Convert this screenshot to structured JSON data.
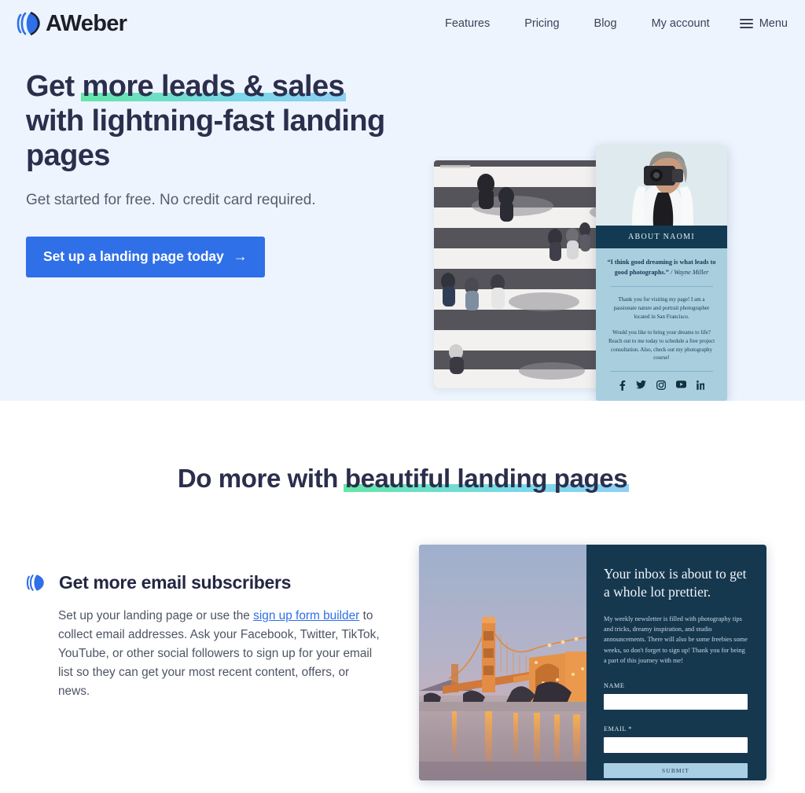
{
  "header": {
    "logo_text": "AWeber",
    "logo_icon": "aweber-mark-icon",
    "nav": [
      {
        "label": "Features"
      },
      {
        "label": "Pricing"
      },
      {
        "label": "Blog"
      },
      {
        "label": "My account"
      }
    ],
    "menu_label": "Menu",
    "menu_icon": "hamburger-icon"
  },
  "hero": {
    "title_part1": "Get ",
    "title_highlight": "more leads & sales",
    "title_part2": "with lightning-fast landing pages",
    "subtitle": "Get started for free. No credit card required.",
    "cta_label": "Set up a landing page today",
    "cta_arrow": "→",
    "background": "#edf4fe",
    "accent": "#2f6fe8",
    "highlight_gradient_from": "#63e6a8",
    "highlight_gradient_to": "#8fd0f5",
    "street_image_alt": "aerial photo of people walking on a striped crosswalk",
    "naomi_card": {
      "photo_alt": "woman taking a photo with a camera",
      "bar_title": "ABOUT NAOMI",
      "quote": "“I think good dreaming is what leads to good photographs.”",
      "quote_source": " / Wayne Miller",
      "paragraph1": "Thank you for visiting my page! I am a passionate nature and portrait photographer located in San Francisco.",
      "paragraph2": "Would you like to bring your dreams to life? Reach out to me today to schedule a free project consultation. Also, check out my photography course!",
      "social": [
        {
          "name": "facebook-icon"
        },
        {
          "name": "twitter-icon"
        },
        {
          "name": "instagram-icon"
        },
        {
          "name": "youtube-icon"
        },
        {
          "name": "linkedin-icon"
        }
      ]
    }
  },
  "section2": {
    "title_part1": "Do more with ",
    "title_highlight": "beautiful landing pages",
    "feature": {
      "icon": "aweber-mark-icon",
      "title": "Get more email subscribers",
      "text_before_link": "Set up your landing page or use the ",
      "link_label": "sign up form builder",
      "text_after_link": " to collect email addresses. Ask your Facebook, Twitter, TikTok, YouTube, or other social followers to sign up for your email list so they can get your most recent content, offers, or news."
    },
    "landing_preview": {
      "photo_alt": "Golden Gate Bridge at dusk reflected on wet sand",
      "heading": "Your inbox is about to get a whole lot prettier.",
      "paragraph": "My weekly newsletter is filled with photography tips and tricks, dreamy inspiration, and studio announcements. There will also be some freebies some weeks, so don't forget to sign up! Thank you for being a part of this journey with me!",
      "name_label": "NAME",
      "name_value": "",
      "email_label": "EMAIL *",
      "email_value": "",
      "submit_label": "SUBMIT",
      "panel_color": "#16384f",
      "submit_color": "#a9cfe4"
    }
  }
}
